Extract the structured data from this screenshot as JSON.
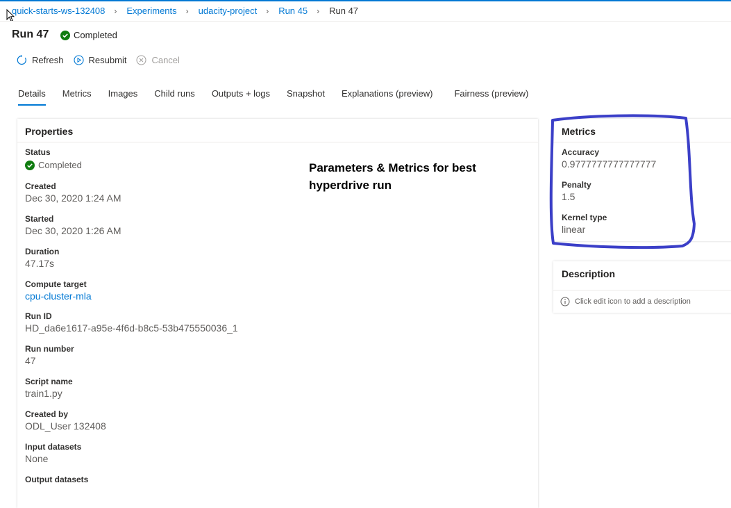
{
  "breadcrumb": {
    "items": [
      "quick-starts-ws-132408",
      "Experiments",
      "udacity-project",
      "Run 45"
    ],
    "current": "Run 47"
  },
  "page": {
    "title": "Run 47",
    "status": "Completed"
  },
  "toolbar": {
    "refresh": "Refresh",
    "resubmit": "Resubmit",
    "cancel": "Cancel"
  },
  "tabs": [
    "Details",
    "Metrics",
    "Images",
    "Child runs",
    "Outputs + logs",
    "Snapshot",
    "Explanations (preview)",
    "Fairness (preview)"
  ],
  "properties": {
    "title": "Properties",
    "items": [
      {
        "label": "Status",
        "value": "Completed"
      },
      {
        "label": "Created",
        "value": "Dec 30, 2020 1:24 AM"
      },
      {
        "label": "Started",
        "value": "Dec 30, 2020 1:26 AM"
      },
      {
        "label": "Duration",
        "value": "47.17s"
      },
      {
        "label": "Compute target",
        "value": "cpu-cluster-mla"
      },
      {
        "label": "Run ID",
        "value": "HD_da6e1617-a95e-4f6d-b8c5-53b475550036_1"
      },
      {
        "label": "Run number",
        "value": "47"
      },
      {
        "label": "Script name",
        "value": "train1.py"
      },
      {
        "label": "Created by",
        "value": "ODL_User 132408"
      },
      {
        "label": "Input datasets",
        "value": "None"
      },
      {
        "label": "Output datasets",
        "value": ""
      }
    ]
  },
  "annotation": {
    "line1": "Parameters & Metrics for best",
    "line2": "hyperdrive run"
  },
  "metrics": {
    "title": "Metrics",
    "items": [
      {
        "label": "Accuracy",
        "value": "0.9777777777777777"
      },
      {
        "label": "Penalty",
        "value": "1.5"
      },
      {
        "label": "Kernel type",
        "value": "linear"
      }
    ]
  },
  "description": {
    "title": "Description",
    "hint": "Click edit icon to add a description"
  },
  "colors": {
    "accent": "#0078d4",
    "success": "#107c10",
    "annotation_ink": "#3b3fc8"
  }
}
